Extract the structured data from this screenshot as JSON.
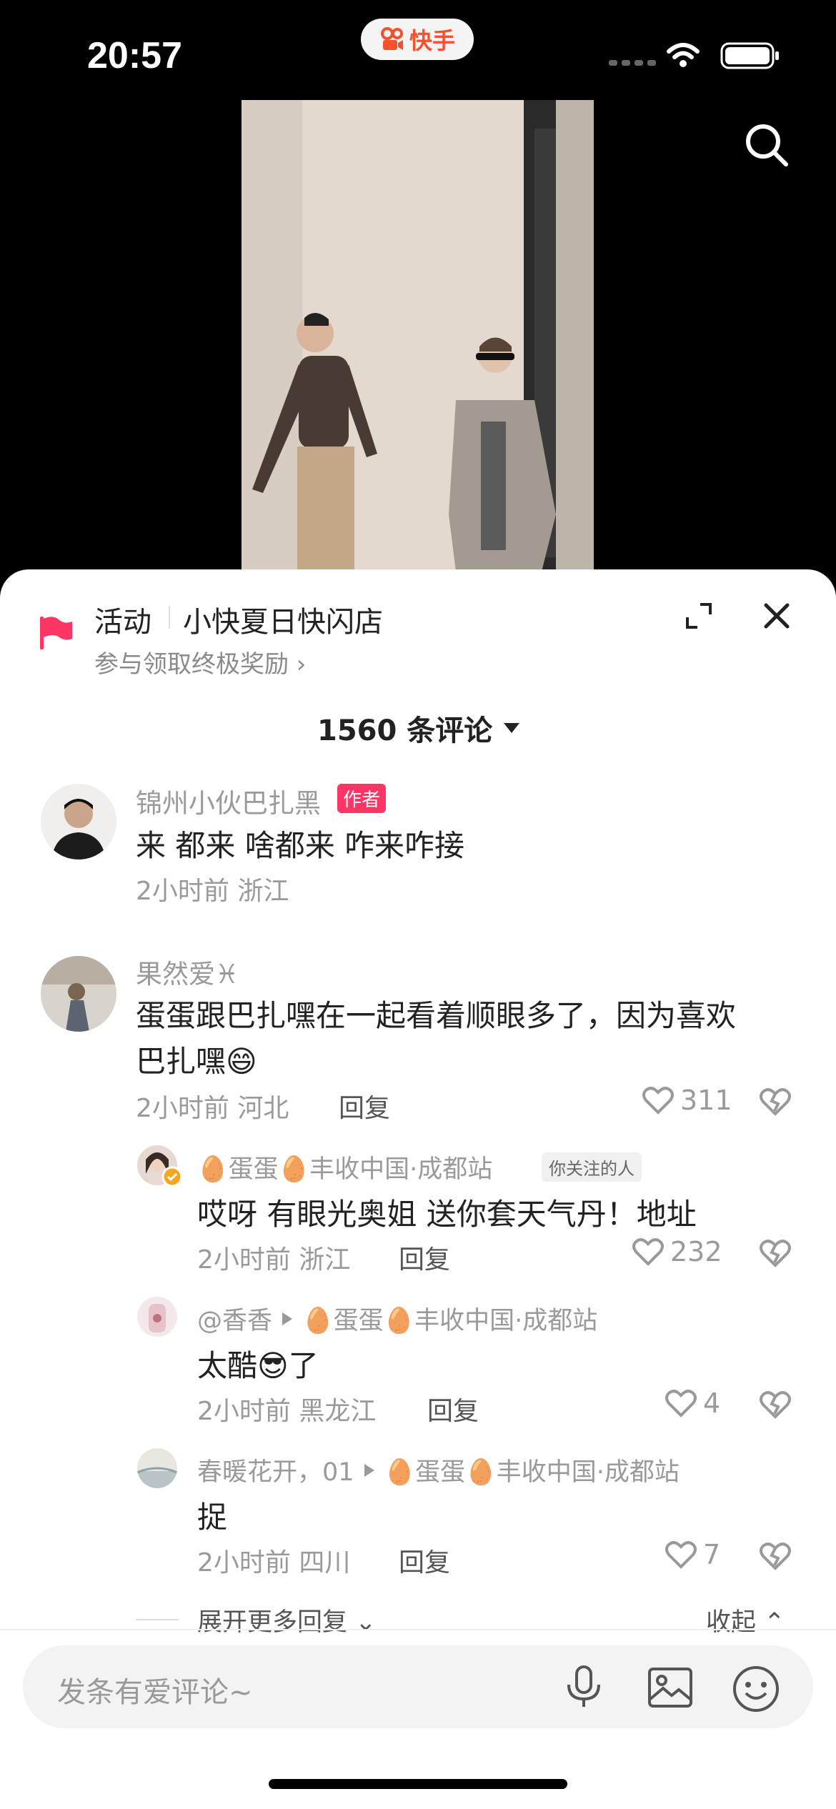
{
  "status_bar": {
    "time": "20:57",
    "app_name": "快手"
  },
  "activity": {
    "label": "活动",
    "title": "小快夏日快闪店",
    "subtitle": "参与领取终极奖励 ›"
  },
  "comments_header": {
    "count_label": "1560 条评论"
  },
  "comments": [
    {
      "user": "锦州小伙巴扎黑",
      "badge": "作者",
      "text": "来 都来 啥都来 咋来咋接",
      "meta": "2小时前 浙江"
    },
    {
      "user": "果然爱♓",
      "text1": "蛋蛋跟巴扎嘿在一起看着顺眼多了，因为喜欢",
      "text2": "巴扎嘿😄",
      "meta": "2小时前 河北",
      "reply_label": "回复",
      "likes": "311"
    }
  ],
  "replies": [
    {
      "user": "🥚蛋蛋🥚丰收中国·成都站",
      "badge": "你关注的人",
      "text": "哎呀 有眼光奥姐 送你套天气丹！地址",
      "meta": "2小时前 浙江",
      "reply_label": "回复",
      "likes": "232"
    },
    {
      "user": "@香香",
      "target": "🥚蛋蛋🥚丰收中国·成都站",
      "text": "太酷😎了",
      "meta": "2小时前 黑龙江",
      "reply_label": "回复",
      "likes": "4"
    },
    {
      "user": "春暖花开，01",
      "target": "🥚蛋蛋🥚丰收中国·成都站",
      "text": "捉",
      "meta": "2小时前 四川",
      "reply_label": "回复",
      "likes": "7"
    }
  ],
  "expand": {
    "more_label": "展开更多回复 ⌄",
    "collapse_label": "收起 ⌃"
  },
  "input": {
    "placeholder": "发条有爱评论~"
  },
  "colors": {
    "accent": "#fe3666",
    "brand": "#f2522e"
  }
}
